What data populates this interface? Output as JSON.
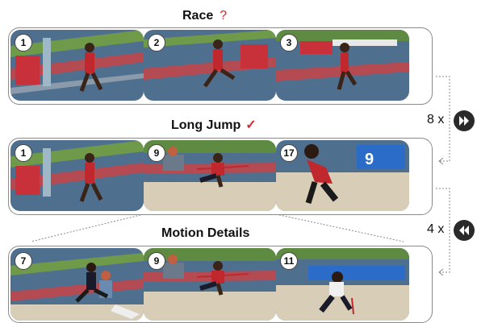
{
  "rows": [
    {
      "title": "Race",
      "mark": "?",
      "frames": [
        "1",
        "2",
        "3"
      ]
    },
    {
      "title": "Long Jump",
      "mark": "✓",
      "frames": [
        "1",
        "9",
        "17"
      ]
    },
    {
      "title": "Motion Details",
      "mark": "",
      "frames": [
        "7",
        "9",
        "11"
      ]
    }
  ],
  "side": {
    "fast_label": "8 x",
    "slow_label": "4 x",
    "fast_icon": "fast-forward-icon",
    "slow_icon": "rewind-icon"
  },
  "colors": {
    "mark": "#d9242b",
    "track": "#4f6f8f",
    "lane": "#b44a52",
    "sand": "#d8cdb6"
  }
}
